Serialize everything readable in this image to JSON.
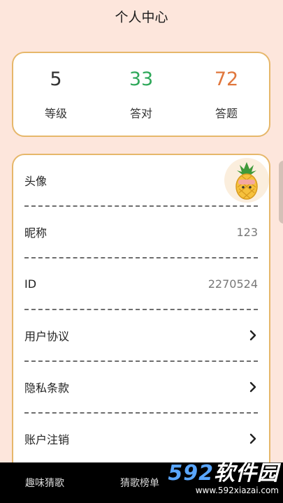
{
  "header": {
    "title": "个人中心"
  },
  "stats": [
    {
      "value": "5",
      "label": "等级",
      "color": "#333333"
    },
    {
      "value": "33",
      "label": "答对",
      "color": "#2fa85a"
    },
    {
      "value": "72",
      "label": "答题",
      "color": "#e0773d"
    }
  ],
  "profile": {
    "avatar_label": "头像",
    "nickname_label": "昵称",
    "nickname_value": "123",
    "id_label": "ID",
    "id_value": "2270524",
    "agreement_label": "用户协议",
    "privacy_label": "隐私条款",
    "cancel_label": "账户注销"
  },
  "tabbar": {
    "tab1": "趣味猜歌",
    "tab2": "猜歌榜单"
  },
  "watermark": {
    "logo_num": "592",
    "logo_text": "软件园",
    "url": "www.592xiazai.com"
  },
  "colors": {
    "accent_border": "#e6b76a",
    "background": "#fde6dc"
  }
}
